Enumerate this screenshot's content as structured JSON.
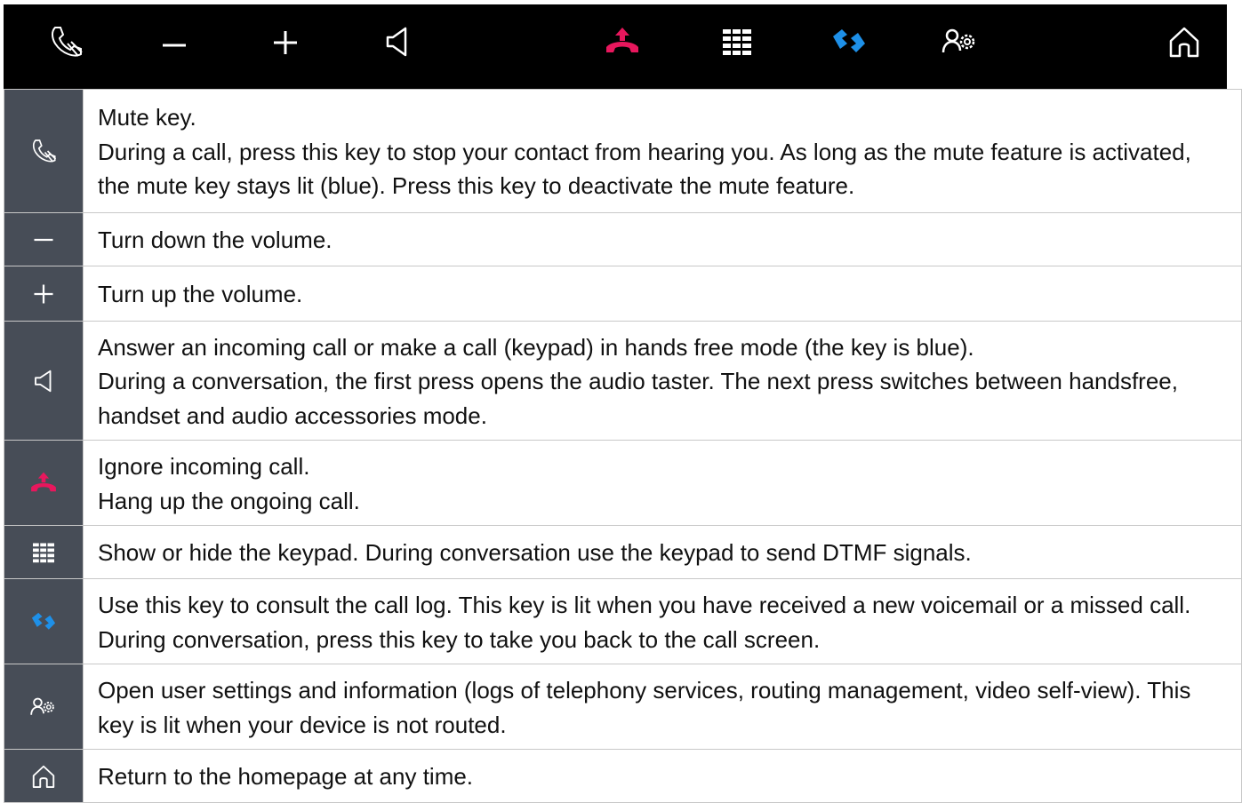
{
  "topbar": {
    "keys": [
      {
        "name": "mute-icon",
        "color": "#ffffff"
      },
      {
        "name": "minus-icon",
        "color": "#ffffff"
      },
      {
        "name": "plus-icon",
        "color": "#ffffff"
      },
      {
        "name": "speaker-icon",
        "color": "#ffffff"
      },
      {
        "name": "hang-up-icon",
        "color": "#e8175d"
      },
      {
        "name": "keypad-icon",
        "color": "#ffffff"
      },
      {
        "name": "call-log-icon",
        "color": "#1e90e8"
      },
      {
        "name": "user-settings-icon",
        "color": "#ffffff"
      },
      {
        "name": "home-icon",
        "color": "#ffffff"
      }
    ]
  },
  "rows": [
    {
      "icon": "mute-icon",
      "lines": [
        "Mute key.",
        "During a call, press this key to stop your contact from hearing you. As long as the mute feature is activated, the mute key stays lit (blue). Press this key to deactivate the mute feature."
      ]
    },
    {
      "icon": "minus-icon",
      "lines": [
        "Turn down the volume."
      ]
    },
    {
      "icon": "plus-icon",
      "lines": [
        "Turn up the volume."
      ]
    },
    {
      "icon": "speaker-icon",
      "lines": [
        "Answer an incoming call or make a call (keypad) in hands free mode (the key is blue).",
        "During a conversation, the first press opens the audio taster. The next press switches between handsfree, handset and audio accessories mode."
      ]
    },
    {
      "icon": "hang-up-icon",
      "lines": [
        "Ignore incoming call.",
        "Hang up the ongoing call."
      ]
    },
    {
      "icon": "keypad-icon",
      "lines": [
        "Show or hide the keypad. During conversation use the keypad to send DTMF signals."
      ]
    },
    {
      "icon": "call-log-icon",
      "lines": [
        "Use this key to consult the call log. This key is lit when you have received a new voicemail or a missed call. During conversation, press this key to take you back to the call screen."
      ]
    },
    {
      "icon": "user-settings-icon",
      "lines": [
        "Open user settings and information (logs of telephony services, routing management, video self-view). This key is lit when your device is not routed."
      ]
    },
    {
      "icon": "home-icon",
      "lines": [
        "Return to the homepage at any time."
      ]
    }
  ],
  "colors": {
    "hang_up": "#e8175d",
    "call_log": "#1e90e8",
    "icon_cell_bg": "#474d57",
    "topbar_bg": "#000000"
  }
}
